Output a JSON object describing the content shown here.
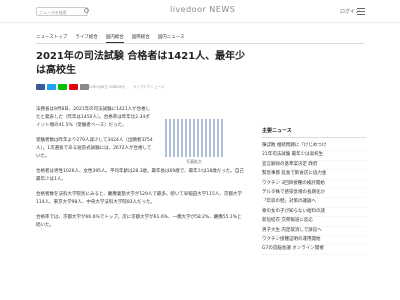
{
  "header": {
    "search_placeholder": "ニュースを検索",
    "logo": "livedoor NEWS",
    "user_label": "ログイン"
  },
  "nav": {
    "items": [
      "ニューストップ",
      "ライフ総合",
      "国内総合",
      "国際総合",
      "国内ニュース"
    ]
  },
  "article": {
    "title": "2021年の司法試験 合格者は1421人、最年少は高校生",
    "date": "2021年9月8日 20時26分",
    "source": "ライブドアニュース",
    "paragraphs": [
      "法務省は9月8日、2021年の司法試験に1421人が合格したと発表した（昨年は1450人）。合格率は昨年比2.34ポイント増の41.5%（受験者ベース）だった。",
      "受験者数は昨年より279人減少して3424人（出願者3754人）。1次選抜である短答式試験には、2672人が合格していた。",
      "合格者は男性1026人、女性395人。平均年齢は28.3歳。最年長は69歳で、最年少は18歳だった。自己最年少は1人。",
      "合格者数を法科大学院別にみると、慶應義塾大学が129人で最多。続いて早稲田大学115人、京都大学114人、東京大学98人、中央大学法科大学院83人だった。",
      "合格率では、京都大学が66.6%でトップ。次に京都大学が61.6%、一橋大学が58.2%、慶應55.1%と続いた。"
    ],
    "photo_caption": "写真拡大"
  },
  "sidebar": {
    "title": "主要ニュース",
    "items": [
      "陳ぽ敗 相続問題に「けじめつけ",
      "21年司法試験 最年少は高校生",
      "宣言解除の基準案決定 政府",
      "緊急事態 延長で飲食店に協力金",
      "ワクチン 3回目接種の検討開始",
      "デルタ株で感染急増の長期化か",
      "「年収の壁」対策の議論へ",
      "寮の女の子が知らない給料の謎",
      "新垣結衣 交際報道に反応",
      "男子大生 内定取消しで訴訟へ",
      "ワクチン接種証明の運用開始",
      "G7の首脳会議 オンライン開催"
    ]
  },
  "colors": {
    "share": [
      "#3b5998",
      "#1da1f2",
      "#00c300",
      "#e60012",
      "#888888"
    ]
  }
}
